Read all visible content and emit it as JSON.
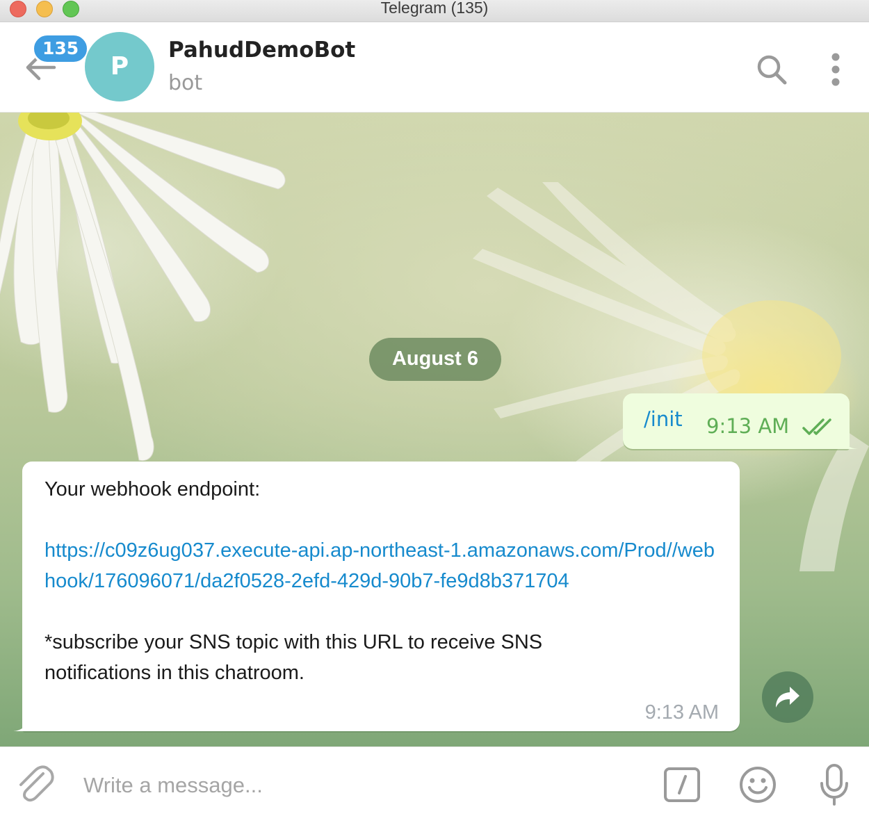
{
  "window": {
    "title": "Telegram (135)"
  },
  "header": {
    "unread_count": "135",
    "avatar_letter": "P",
    "chat_name": "PahudDemoBot",
    "chat_status": "bot"
  },
  "chat": {
    "date_label": "August 6",
    "messages": [
      {
        "direction": "outgoing",
        "text": "/init",
        "time": "9:13 AM",
        "status": "read"
      },
      {
        "direction": "incoming",
        "intro": "Your webhook endpoint:",
        "link": "https://c09z6ug037.execute-api.ap-northeast-1.amazonaws.com/Prod//webhook/176096071/da2f0528-2efd-429d-90b7-fe9d8b371704",
        "note": "*subscribe your SNS topic with this URL to receive SNS notifications in this chatroom.",
        "time": "9:13 AM"
      }
    ]
  },
  "composer": {
    "placeholder": "Write a message..."
  },
  "icons": {
    "back": "arrow-left-icon",
    "search": "search-icon",
    "more": "more-vertical-icon",
    "read_status": "double-check-icon",
    "share": "share-arrow-icon",
    "attach": "paperclip-icon",
    "commands": "slash-command-icon",
    "emoji": "emoji-icon",
    "voice": "microphone-icon"
  },
  "colors": {
    "accent": "#168acd",
    "badge": "#3e9de2",
    "avatar": "#74c9cc",
    "outgoing_bubble": "#effdde",
    "outgoing_time": "#5fae56"
  }
}
